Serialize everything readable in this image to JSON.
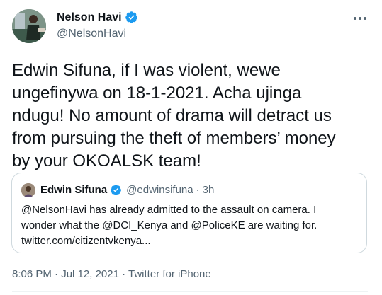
{
  "author": {
    "display_name": "Nelson Havi",
    "handle": "@NelsonHavi"
  },
  "tweet": {
    "text": "Edwin Sifuna, if I was violent, wewe\nungefinywa on 18-1-2021. Acha ujinga\nndugu!  No amount of drama will detract us\nfrom pursuing the theft of members’ money\nby your OKOALSK team!"
  },
  "quoted_tweet": {
    "display_name": "Edwin Sifuna",
    "handle": "@edwinsifuna",
    "separator": "·",
    "time": "3h",
    "text": "@NelsonHavi has already admitted to the assault on camera. I\nwonder what the @DCI_Kenya and @PoliceKE are waiting for.\ntwitter.com/citizentvkenya..."
  },
  "meta": {
    "time": "8:06 PM",
    "sep1": " · ",
    "date": "Jul 12, 2021",
    "sep2": " · ",
    "source": "Twitter for iPhone"
  },
  "icons": {
    "verified": "verified-badge-icon",
    "more": "more-horizontal-icon"
  },
  "colors": {
    "verified": "#1d9bf0",
    "secondary_text": "#536471",
    "border": "#cfd9de"
  }
}
